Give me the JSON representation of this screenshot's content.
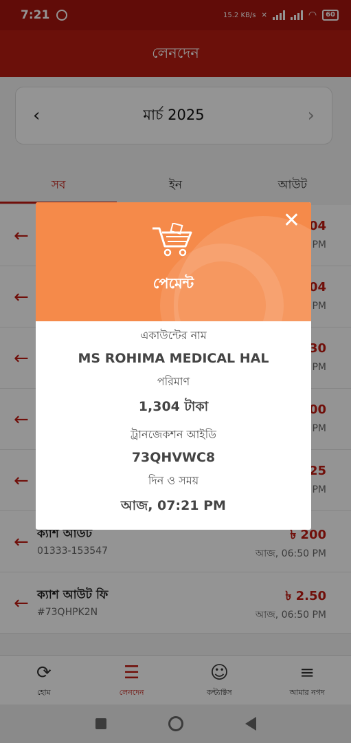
{
  "status_bar": {
    "time": "7:21",
    "net_speed": "15.2 KB/s",
    "battery": "60"
  },
  "app_bar": {
    "title": "লেনদেন"
  },
  "month_selector": {
    "prev": "‹",
    "month": "মার্চ 2025",
    "next": "›"
  },
  "tabs": [
    {
      "label": "সব",
      "active": true
    },
    {
      "label": "ইন",
      "active": false
    },
    {
      "label": "আউট",
      "active": false
    }
  ],
  "transactions": [
    {
      "title": "",
      "sub": "",
      "amount": "04",
      "time": "PM"
    },
    {
      "title": "",
      "sub": "",
      "amount": "04",
      "time": "PM"
    },
    {
      "title": "",
      "sub": "",
      "amount": "30",
      "time": "PM"
    },
    {
      "title": "",
      "sub": "",
      "amount": "00",
      "time": "PM"
    },
    {
      "title": "",
      "sub": "",
      "amount": "25",
      "time": "PM"
    },
    {
      "title": "ক্যাশ আউট",
      "sub": "01333-153547",
      "amount": "৳ 200",
      "time": "আজ, 06:50 PM"
    },
    {
      "title": "ক্যাশ আউট ফি",
      "sub": "#73QHPK2N",
      "amount": "৳ 2.50",
      "time": "আজ, 06:50 PM"
    }
  ],
  "bottom_nav": [
    {
      "label": "হোম",
      "icon": "home-icon"
    },
    {
      "label": "লেনদেন",
      "icon": "transactions-icon",
      "active": true
    },
    {
      "label": "কন্ট্যাক্টস",
      "icon": "contacts-icon"
    },
    {
      "label": "আমার নগদ",
      "icon": "menu-icon"
    }
  ],
  "modal": {
    "close": "✕",
    "title": "পেমেন্ট",
    "icon": "cart-icon",
    "fields": [
      {
        "label": "একাউন্টের নাম",
        "value": "MS ROHIMA MEDICAL HAL"
      },
      {
        "label": "পরিমাণ",
        "value": "1,304 টাকা"
      },
      {
        "label": "ট্রানজেকশন আইডি",
        "value": "73QHVWC8"
      },
      {
        "label": "দিন ও সময়",
        "value": "আজ, 07:21 PM"
      }
    ]
  },
  "colors": {
    "brand_red": "#b91d12",
    "modal_orange": "#f58a4a"
  }
}
